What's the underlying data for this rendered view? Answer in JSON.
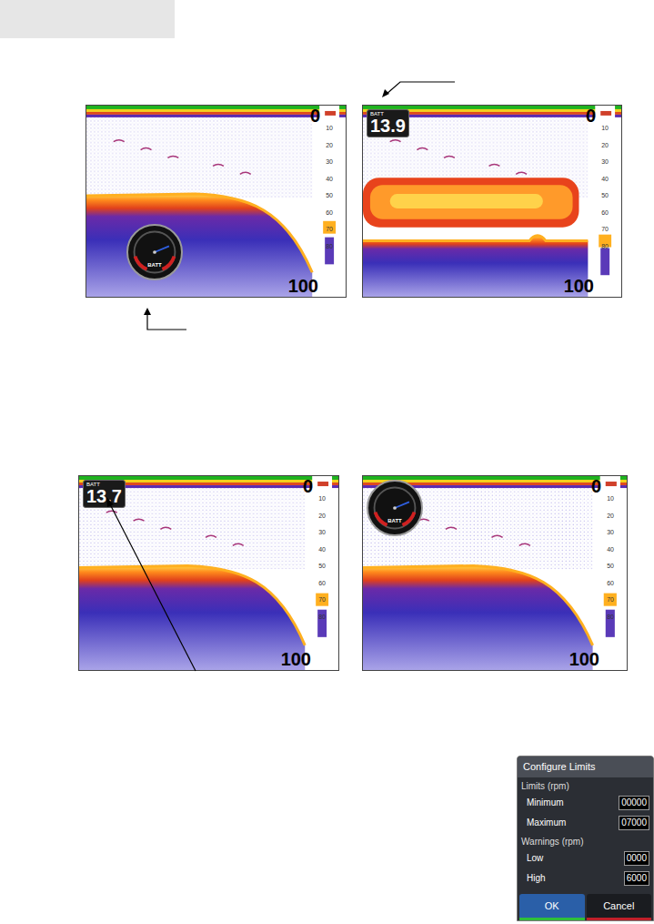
{
  "screens": [
    {
      "depth_top": "0",
      "depth_bottom": "100",
      "ticks": [
        "10",
        "20",
        "30",
        "40",
        "50",
        "60",
        "70",
        "80"
      ],
      "gauge": {
        "kind": "dial",
        "label": "BATT",
        "corner": "bottom-left"
      },
      "bottom": "slope",
      "school": false
    },
    {
      "depth_top": "0",
      "depth_bottom": "100",
      "ticks": [
        "10",
        "20",
        "30",
        "40",
        "50",
        "60",
        "70",
        "80"
      ],
      "gauge": {
        "kind": "digital",
        "label": "BATT",
        "reading": "13.9",
        "corner": "top-left"
      },
      "bottom": "flat",
      "school": true
    },
    {
      "depth_top": "0",
      "depth_bottom": "100",
      "ticks": [
        "10",
        "20",
        "30",
        "40",
        "50",
        "60",
        "70",
        "80"
      ],
      "gauge": {
        "kind": "digital",
        "label": "BATT",
        "reading": "13.7",
        "corner": "top-left"
      },
      "bottom": "slope",
      "school": false
    },
    {
      "depth_top": "0",
      "depth_bottom": "100",
      "ticks": [
        "10",
        "20",
        "30",
        "40",
        "50",
        "60",
        "70",
        "80"
      ],
      "gauge": {
        "kind": "dial",
        "label": "BATT",
        "corner": "top-left"
      },
      "bottom": "slope",
      "school": false
    }
  ],
  "dialog": {
    "title": "Configure Limits",
    "groups": [
      {
        "label": "Limits (rpm)",
        "fields": [
          {
            "label": "Minimum",
            "value": "00000"
          },
          {
            "label": "Maximum",
            "value": "07000"
          }
        ]
      },
      {
        "label": "Warnings (rpm)",
        "fields": [
          {
            "label": "Low",
            "value": "0000"
          },
          {
            "label": "High",
            "value": "6000"
          }
        ]
      }
    ],
    "buttons": [
      {
        "label": "OK",
        "selected": true
      },
      {
        "label": "Cancel",
        "selected": false
      }
    ]
  }
}
